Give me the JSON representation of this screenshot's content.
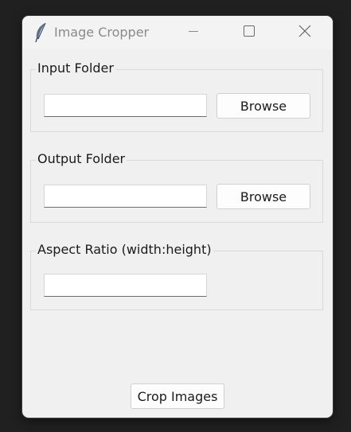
{
  "window": {
    "title": "Image Cropper",
    "icon": "feather-icon"
  },
  "titlebar": {
    "minimize_icon": "minimize-icon",
    "maximize_icon": "maximize-icon",
    "close_icon": "close-icon"
  },
  "input_folder": {
    "label": "Input Folder",
    "value": "",
    "browse_label": "Browse"
  },
  "output_folder": {
    "label": "Output Folder",
    "value": "",
    "browse_label": "Browse"
  },
  "aspect_ratio": {
    "label": "Aspect Ratio (width:height)",
    "value": ""
  },
  "actions": {
    "crop_label": "Crop Images"
  },
  "colors": {
    "window_bg": "#f0f0f0",
    "titlebar_bg": "#f3f3f3",
    "desktop_bg": "#202020",
    "title_text": "#8a8a8a"
  }
}
